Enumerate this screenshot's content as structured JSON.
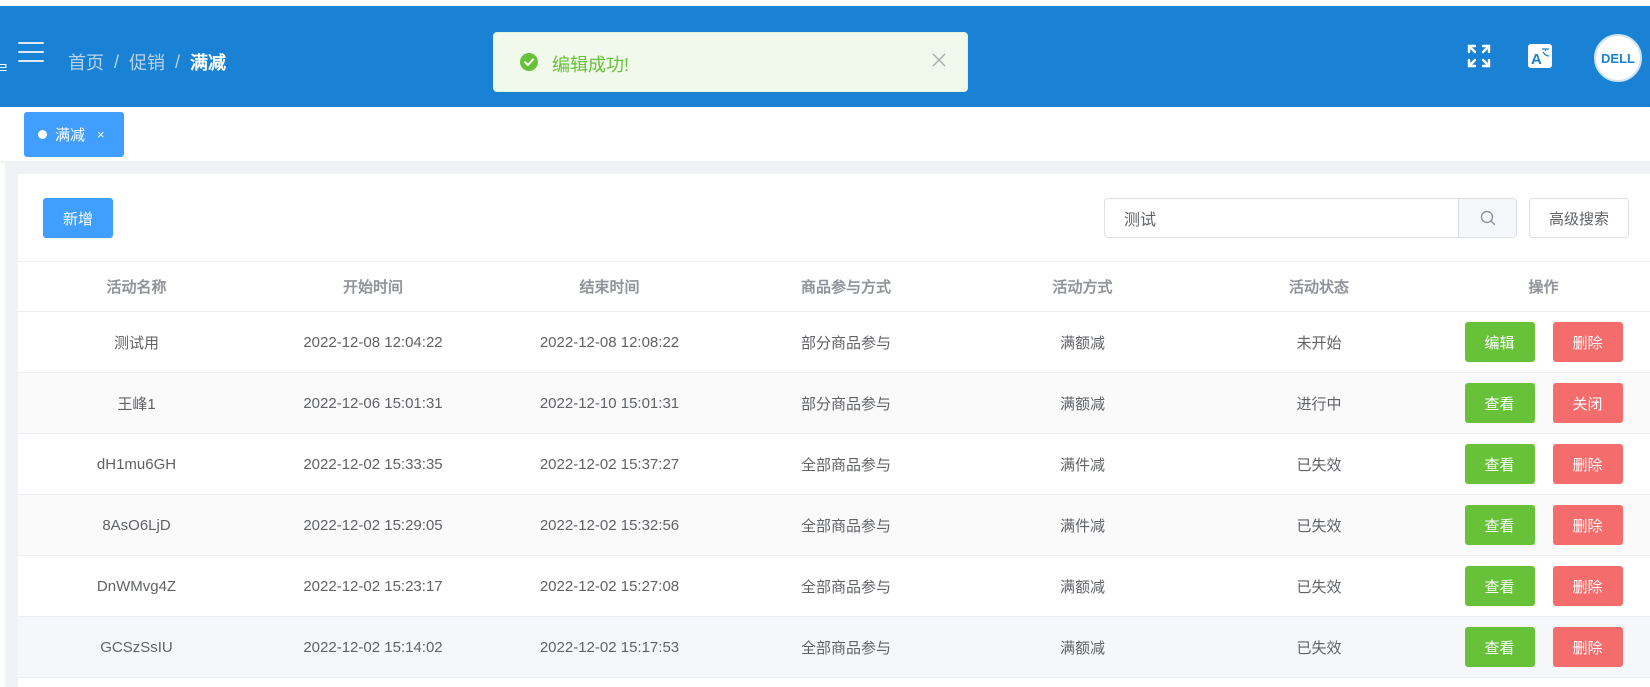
{
  "header": {
    "breadcrumb": {
      "home": "首页",
      "promo": "促销",
      "current": "满减",
      "sep": "/"
    },
    "edge_glyph": "ㄹ"
  },
  "toast": {
    "message": "编辑成功!"
  },
  "tags": [
    {
      "label": "满减",
      "close": "×"
    }
  ],
  "toolbar": {
    "add_label": "新增",
    "search_value": "测试",
    "advanced_label": "高级搜索"
  },
  "table": {
    "columns": [
      "活动名称",
      "开始时间",
      "结束时间",
      "商品参与方式",
      "活动方式",
      "活动状态",
      "操作"
    ],
    "rows": [
      {
        "name": "测试用",
        "start": "2022-12-08 12:04:22",
        "end": "2022-12-08 12:08:22",
        "scope": "部分商品参与",
        "mode": "满额减",
        "status": "未开始",
        "action1": "编辑",
        "action2": "删除"
      },
      {
        "name": "王峰1",
        "start": "2022-12-06 15:01:31",
        "end": "2022-12-10 15:01:31",
        "scope": "部分商品参与",
        "mode": "满额减",
        "status": "进行中",
        "action1": "查看",
        "action2": "关闭"
      },
      {
        "name": "dH1mu6GH",
        "start": "2022-12-02 15:33:35",
        "end": "2022-12-02 15:37:27",
        "scope": "全部商品参与",
        "mode": "满件减",
        "status": "已失效",
        "action1": "查看",
        "action2": "删除"
      },
      {
        "name": "8AsO6LjD",
        "start": "2022-12-02 15:29:05",
        "end": "2022-12-02 15:32:56",
        "scope": "全部商品参与",
        "mode": "满件减",
        "status": "已失效",
        "action1": "查看",
        "action2": "删除"
      },
      {
        "name": "DnWMvg4Z",
        "start": "2022-12-02 15:23:17",
        "end": "2022-12-02 15:27:08",
        "scope": "全部商品参与",
        "mode": "满额减",
        "status": "已失效",
        "action1": "查看",
        "action2": "删除"
      },
      {
        "name": "GCSzSsIU",
        "start": "2022-12-02 15:14:02",
        "end": "2022-12-02 15:17:53",
        "scope": "全部商品参与",
        "mode": "满额减",
        "status": "已失效",
        "action1": "查看",
        "action2": "删除"
      }
    ]
  },
  "colors": {
    "header_bg": "#1a82d4",
    "primary": "#409eff",
    "success": "#67c23a",
    "danger": "#f56c6c"
  },
  "icons": {
    "menu": "hamburger-icon",
    "fullscreen": "fullscreen-icon",
    "language": "translate-icon",
    "toast": "success-check-icon",
    "search": "search-icon"
  }
}
